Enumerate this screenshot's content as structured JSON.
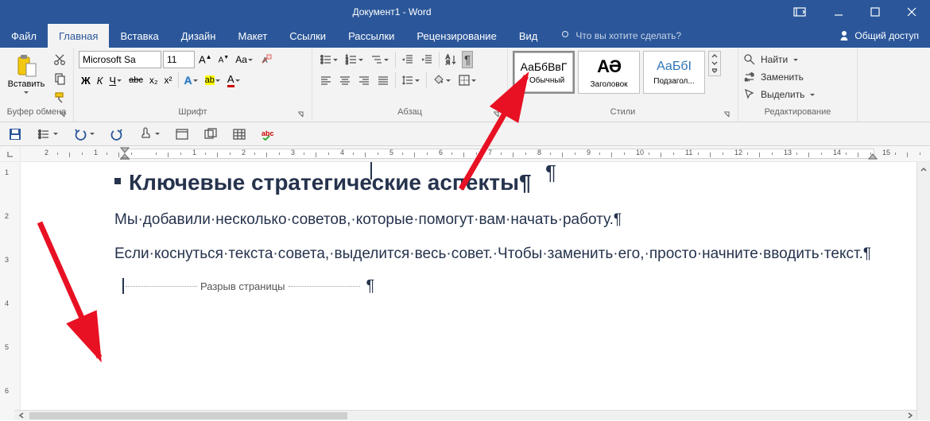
{
  "title": "Документ1 - Word",
  "win": {
    "ribbon_opts": "ribbon-display-options",
    "min": "minimize",
    "max": "maximize",
    "close": "close"
  },
  "tabs": {
    "file": "Файл",
    "home": "Главная",
    "insert": "Вставка",
    "design": "Дизайн",
    "layout": "Макет",
    "references": "Ссылки",
    "mailings": "Рассылки",
    "review": "Рецензирование",
    "view": "Вид"
  },
  "tell_me": "Что вы хотите сделать?",
  "share": "Общий доступ",
  "clipboard": {
    "paste": "Вставить",
    "label": "Буфер обмена"
  },
  "font": {
    "name": "Microsoft Sa",
    "size": "11",
    "bold": "Ж",
    "italic": "К",
    "underline": "Ч",
    "strike": "abc",
    "sub": "x₂",
    "sup": "x²",
    "grow": "A",
    "shrink": "A",
    "case": "Aa",
    "clear": "clear-format",
    "effects": "A",
    "highlight": "ab",
    "color": "A",
    "label": "Шрифт"
  },
  "paragraph": {
    "label": "Абзац",
    "pilcrow": "¶"
  },
  "styles": {
    "normal_sample": "АаБбВвГ",
    "normal": "¶ Обычный",
    "heading_sample": "АƏ",
    "heading": "Заголовок",
    "subheading_sample": "АаБбІ",
    "subheading": "Подзагол...",
    "label": "Стили"
  },
  "editing": {
    "find": "Найти",
    "replace": "Заменить",
    "select": "Выделить",
    "label": "Редактирование"
  },
  "qat": {
    "save": "save",
    "bullets": "bullets",
    "undo": "undo",
    "redo": "redo",
    "touch": "touch",
    "win1": "q1",
    "win2": "q2",
    "table": "table",
    "quick": "quick",
    "abc": "spelling"
  },
  "ruler": {
    "h": [
      "2",
      "1",
      "",
      "1",
      "2",
      "3",
      "4",
      "5",
      "6",
      "7",
      "8",
      "9",
      "10",
      "11",
      "12",
      "13",
      "14",
      "15"
    ],
    "v": [
      "1",
      "2",
      "3",
      "4",
      "5",
      "6"
    ]
  },
  "doc": {
    "heading": "Ключевые стратегические аспекты",
    "p1": "Мы·добавили·несколько·советов,·которые·помогут·вам·начать·работу.",
    "p2": "Если·коснуться·текста·совета,·выделится·весь·совет.·Чтобы·заменить·его,·просто·начните·вводить·текст.",
    "page_break": "Разрыв страницы",
    "pil": "¶"
  }
}
